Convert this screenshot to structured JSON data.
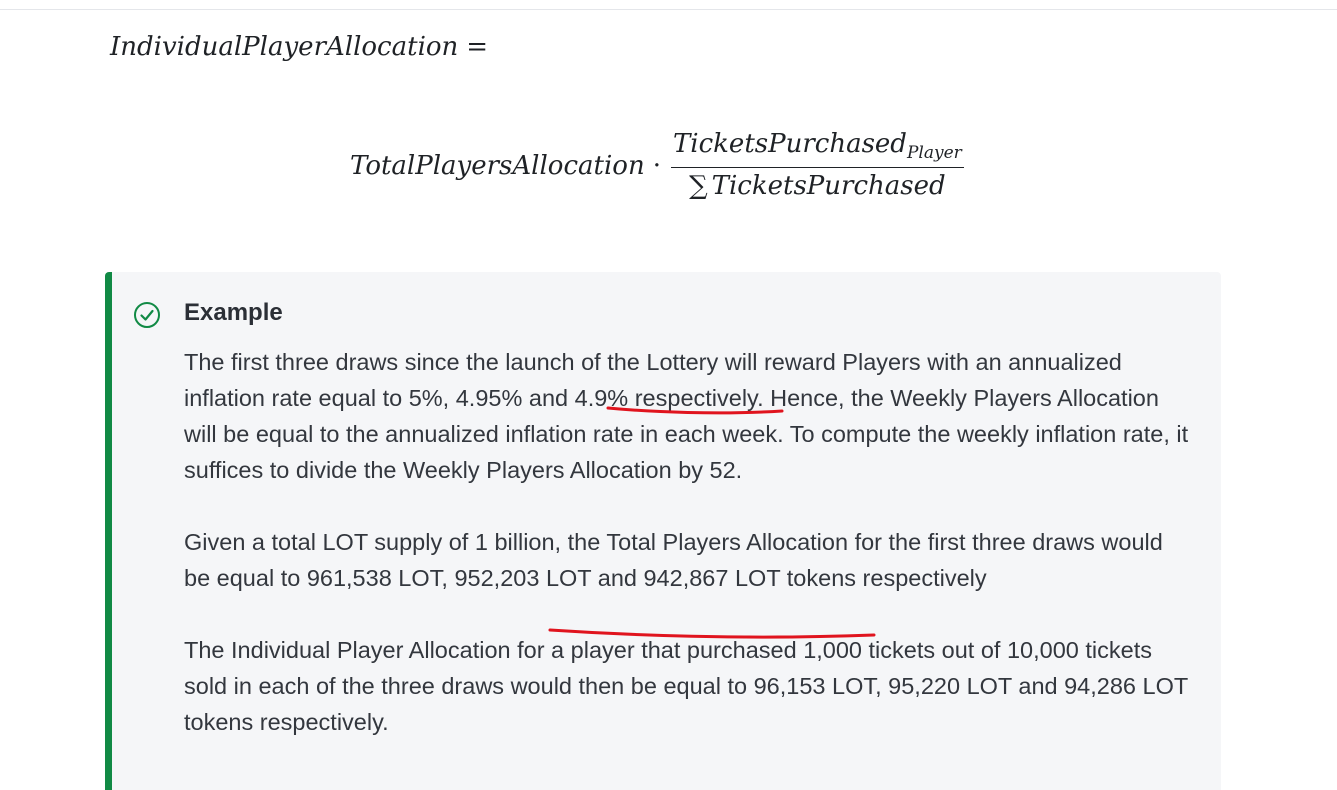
{
  "formula": {
    "lhs": "IndividualPlayerAllocation",
    "equals": "=",
    "rhs_term": "TotalPlayersAllocation",
    "operator": "·",
    "numerator": "TicketsPurchased",
    "numerator_subscript": "Player",
    "sum_symbol": "∑",
    "denominator": "TicketsPurchased"
  },
  "example": {
    "icon": "check-circle-icon",
    "accent_color": "#118a45",
    "title": "Example",
    "p1": {
      "before": "The first three draws since the launch of the Lottery will reward Players with an annualized inflation rate equal to 5%, ",
      "highlight": "4.95% and 4.9%",
      "after": " respectively. Hence, the Weekly Players Allocation will be equal to the annualized inflation rate in each week. To compute the weekly inflation rate, it suffices to divide the Weekly Players Allocation by 52."
    },
    "p2": {
      "before": "Given a total LOT supply of 1 billion, the Total Players Allocation for the first three draws would be equal to 961,538 LOT, ",
      "highlight": "952,203 LOT and 942,867 LOT",
      "after": " tokens respectively"
    },
    "p3": "The Individual Player Allocation for a player that purchased 1,000 tickets out of 10,000 tickets sold in each of the three draws would then be equal to 96,153 LOT, 95,220 LOT and 94,286 LOT tokens respectively."
  },
  "annotation_color": "#e0141e"
}
